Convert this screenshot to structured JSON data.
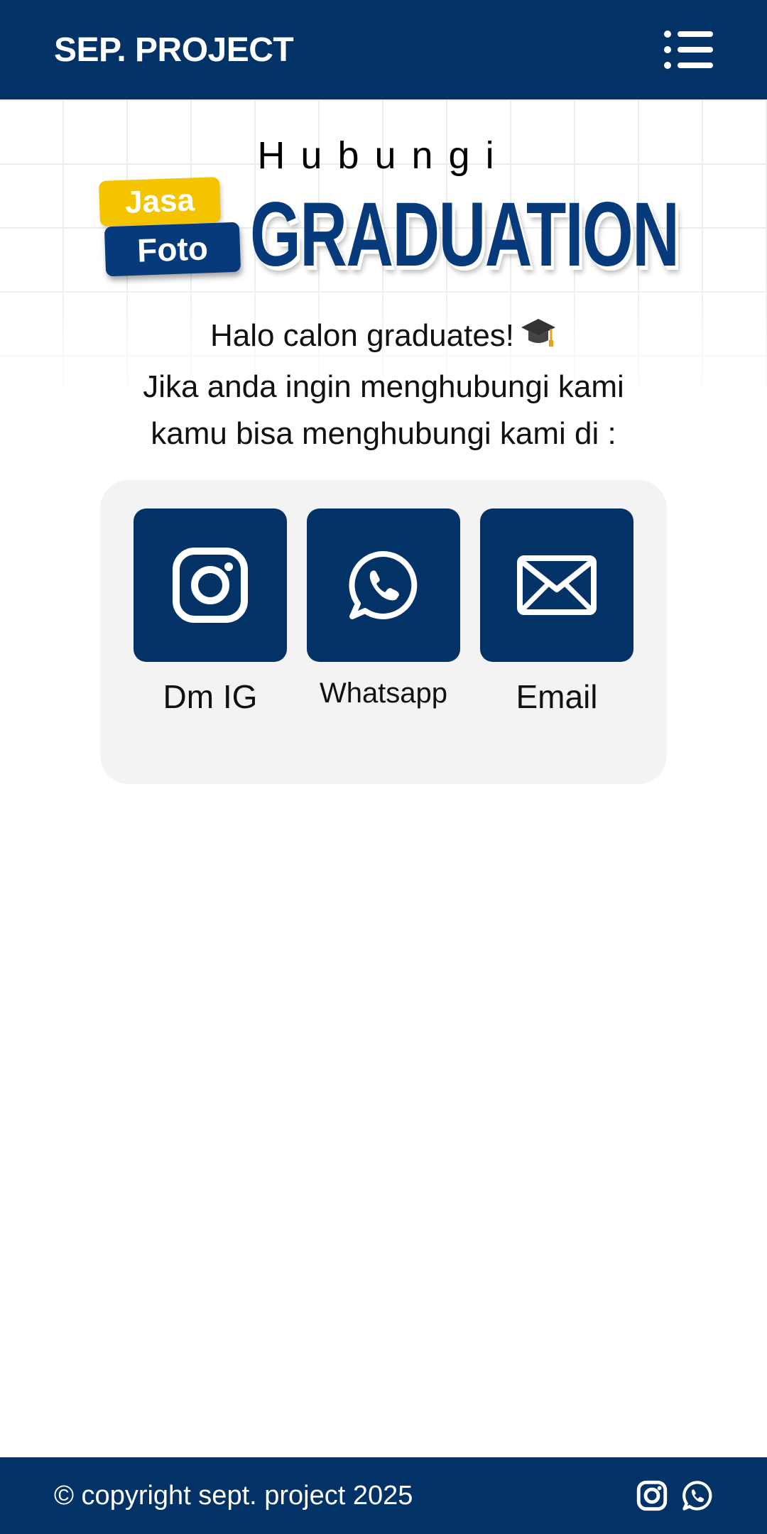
{
  "header": {
    "brand": "SEP. PROJECT",
    "menu_icon": "list-menu-icon"
  },
  "hero": {
    "kicker": "Hubungi",
    "tag_top": "Jasa",
    "tag_bottom": "Foto",
    "title": "GRADUATION"
  },
  "intro": {
    "line1": "Halo calon graduates!",
    "line2": "Jika anda ingin menghubungi kami",
    "line3": "kamu bisa menghubungi kami di :",
    "emoji_icon": "graduation-cap-icon"
  },
  "contacts": [
    {
      "label": "Dm IG",
      "icon": "instagram-icon"
    },
    {
      "label": "Whatsapp",
      "icon": "whatsapp-icon"
    },
    {
      "label": "Email",
      "icon": "envelope-icon"
    }
  ],
  "footer": {
    "copyright": "© copyright sept. project 2025",
    "icons": [
      "instagram-icon",
      "whatsapp-icon"
    ]
  },
  "colors": {
    "primary": "#033266",
    "accent": "#f5c400",
    "card_bg": "#f3f3f3"
  }
}
